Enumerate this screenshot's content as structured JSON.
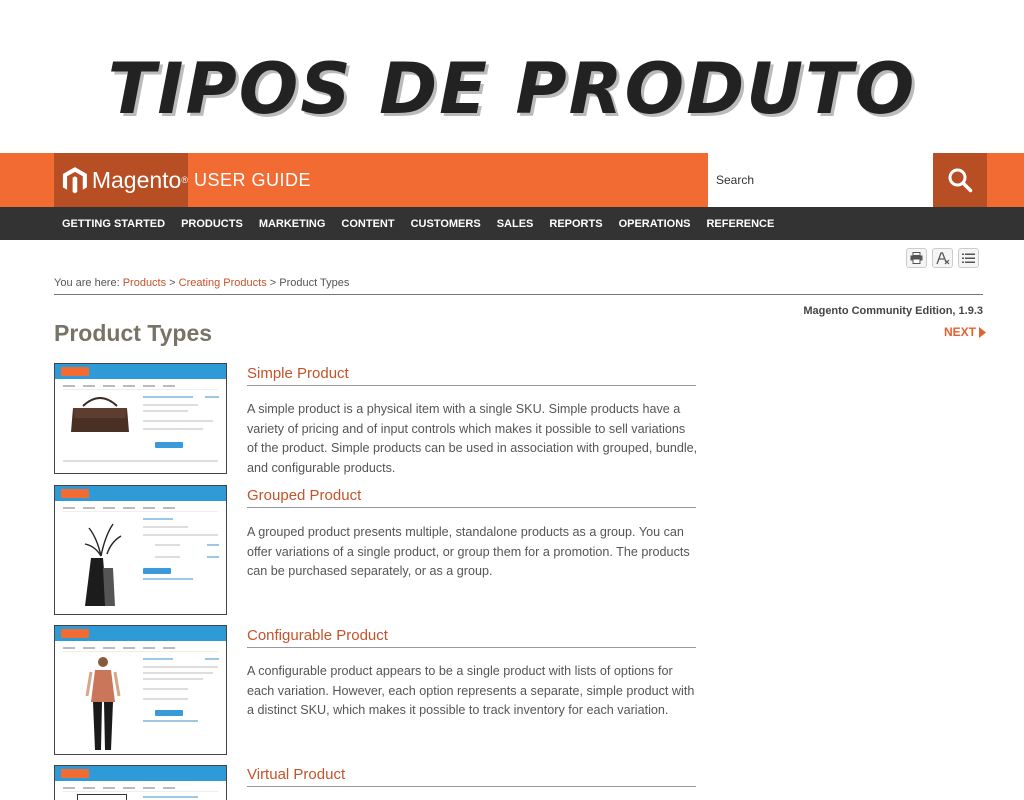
{
  "banner": {
    "title": "TIPOS DE PRODUTO"
  },
  "header": {
    "logo_text": "Magento",
    "logo_sup": "®",
    "guide_label": "USER GUIDE",
    "search_placeholder": "Search"
  },
  "nav": {
    "items": [
      "GETTING STARTED",
      "PRODUCTS",
      "MARKETING",
      "CONTENT",
      "CUSTOMERS",
      "SALES",
      "REPORTS",
      "OPERATIONS",
      "REFERENCE"
    ]
  },
  "breadcrumb": {
    "prefix": "You are here: ",
    "link1": "Products",
    "sep1": " > ",
    "link2": "Creating Products",
    "sep2": " > ",
    "current": "Product Types"
  },
  "edition": "Magento Community Edition, 1.9.3",
  "next_label": "NEXT",
  "page_title": "Product Types",
  "sections": [
    {
      "title": "Simple Product",
      "body": "A simple product is a physical item with a single SKU. Simple products have a variety of pricing and of input controls which makes it possible to sell variations of the product. Simple products can be used in association with grouped, bundle, and configurable products."
    },
    {
      "title": "Grouped Product",
      "body": "A grouped product presents multiple, standalone products as a group. You can offer variations of a single product, or group them for a promotion. The products can be purchased separately, or as a group."
    },
    {
      "title": "Configurable Product",
      "body": "A configurable product appears to be a single product with lists of options for each variation. However, each option represents a separate, simple product with a distinct SKU, which makes it possible to track inventory for each variation."
    },
    {
      "title": "Virtual Product",
      "body": ""
    }
  ],
  "colors": {
    "brand_orange": "#f26b33",
    "brand_dark_orange": "#b84e24",
    "nav_bg": "#333333",
    "link": "#c4532a"
  }
}
